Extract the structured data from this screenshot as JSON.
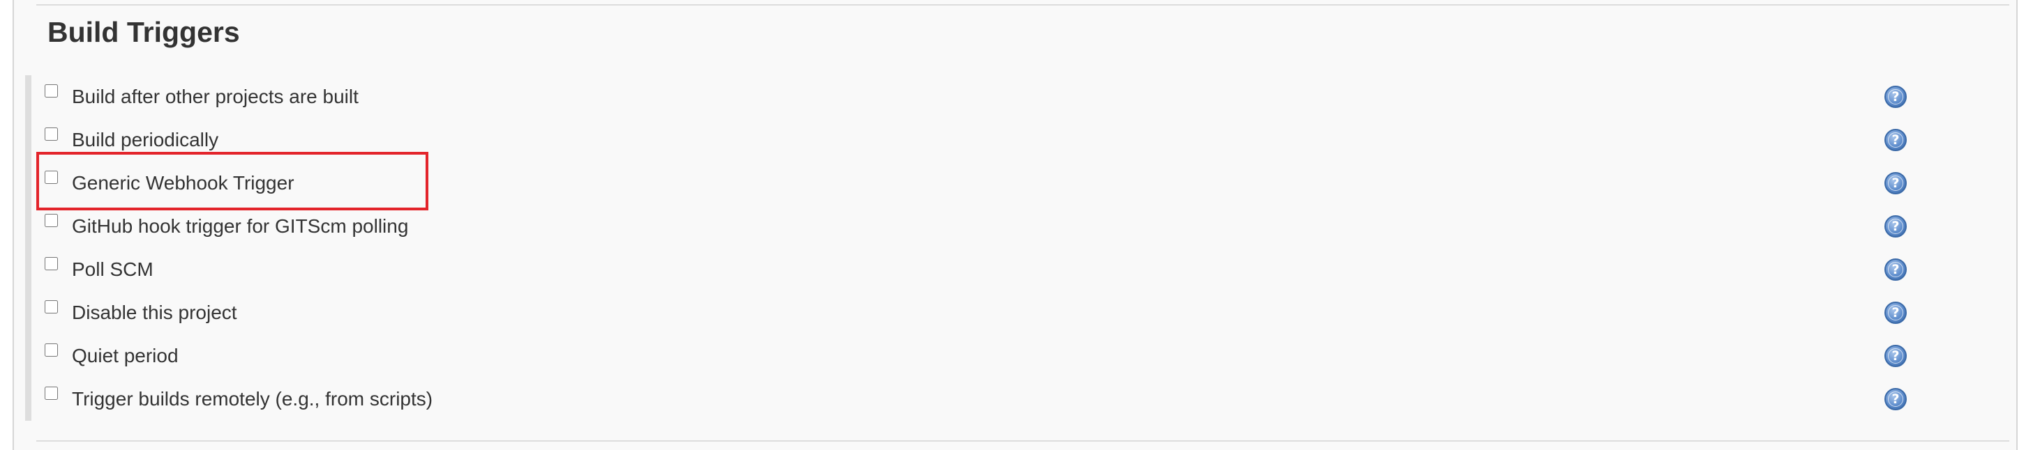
{
  "section": {
    "title": "Build Triggers"
  },
  "triggers": [
    {
      "label": "Build after other projects are built",
      "checked": false,
      "help_icon": "help-question-icon"
    },
    {
      "label": "Build periodically",
      "checked": false,
      "help_icon": "help-question-icon"
    },
    {
      "label": "Generic Webhook Trigger",
      "checked": false,
      "help_icon": "help-question-icon",
      "highlighted": true
    },
    {
      "label": "GitHub hook trigger for GITScm polling",
      "checked": false,
      "help_icon": "help-question-icon"
    },
    {
      "label": "Poll SCM",
      "checked": false,
      "help_icon": "help-question-icon"
    },
    {
      "label": "Disable this project",
      "checked": false,
      "help_icon": "help-question-icon"
    },
    {
      "label": "Quiet period",
      "checked": false,
      "help_icon": "help-question-icon"
    },
    {
      "label": "Trigger builds remotely (e.g., from scripts)",
      "checked": false,
      "help_icon": "help-question-icon"
    }
  ],
  "help": {
    "glyph": "?"
  },
  "colors": {
    "panel_background": "#f9f9f9",
    "text": "#333333",
    "highlight_border": "#e3242b",
    "help_icon_blue": "#5d8ccc"
  }
}
